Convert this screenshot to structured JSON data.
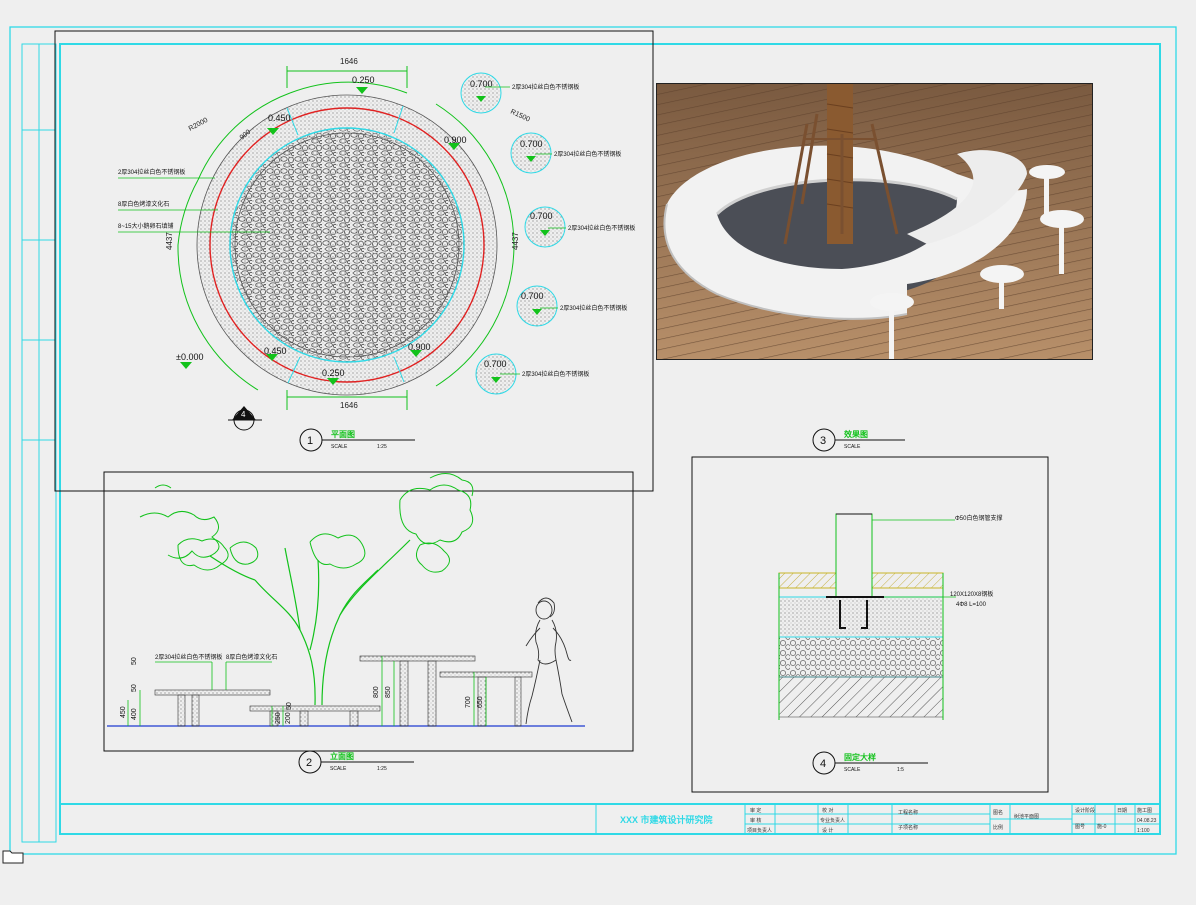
{
  "drawing": {
    "plan": {
      "dim_top": "1646",
      "dim_bottom": "1646",
      "dim_left": "4437",
      "dim_right": "4437",
      "dim_r2000": "R2000",
      "dim_r1500": "R1500",
      "dim_900": "900",
      "level_seat_top": "0.250",
      "level_seat_bottom": "0.250",
      "level_ul": "0.450",
      "level_ll": "0.450",
      "level_ur": "0.900",
      "level_lr": "0.900",
      "level_ground": "±0.000",
      "stools": [
        "0.700",
        "0.700",
        "0.700",
        "0.700",
        "0.700"
      ],
      "stool_note": "2厚304拉丝白色不锈钢板",
      "note_1": "2厚304拉丝白色不锈钢板",
      "note_2": "8厚白色烤漆文化石",
      "note_3": "8~15大小鹅卵石填铺",
      "section_mark": "4",
      "number": "1",
      "title": "平面图",
      "scale_label": "SCALE",
      "scale": "1:25"
    },
    "elevation": {
      "note_left": "2厚304拉丝白色不锈钢板",
      "note_mid": "8厚白色烤漆文化石",
      "dims": [
        "50",
        "400",
        "450",
        "50",
        "250",
        "200",
        "800",
        "850",
        "700",
        "650",
        "50"
      ],
      "number": "2",
      "title": "立面图",
      "scale_label": "SCALE",
      "scale": "1:25"
    },
    "render": {
      "number": "3",
      "title": "效果图",
      "scale_label": "SCALE"
    },
    "detail": {
      "note_top": "Φ50白色钢管支撑",
      "note_bolt_1": "120X120X8钢板",
      "note_bolt_2": "4Φ8 L=100",
      "number": "4",
      "title": "固定大样",
      "scale_label": "SCALE",
      "scale": "1:5"
    },
    "title_block": {
      "company": "XXX 市建筑设计研究院",
      "rows": [
        "审 定",
        "审 核",
        "项目负责人"
      ],
      "rows_2": [
        "校 对",
        "专业负责人",
        "设 计"
      ],
      "cells": [
        "工程名称",
        "子项名称",
        "图名",
        "比例",
        "设计阶段",
        "图号",
        "日期"
      ],
      "drawing_name": "树池平面图",
      "sheet_no": "施-0",
      "stage": "施工图",
      "date": "04.08.23",
      "scale": "1:100"
    },
    "colors": {
      "frame": "#2fd9e6",
      "green": "#12c21b",
      "red": "#e02222",
      "stone": "#888888"
    }
  }
}
